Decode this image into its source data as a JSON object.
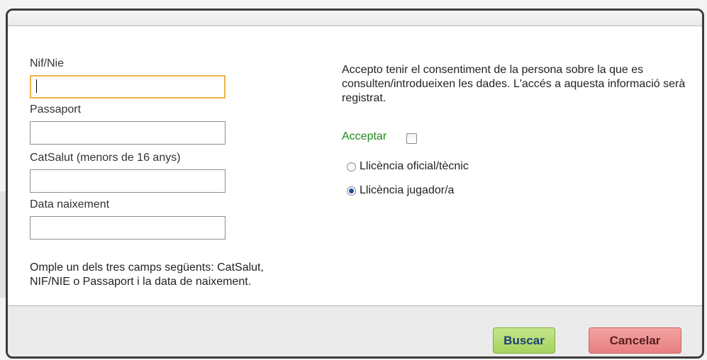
{
  "form": {
    "nif_label": "Nif/Nie",
    "nif_value": "",
    "passport_label": "Passaport",
    "passport_value": "",
    "catsalut_label": "CatSalut (menors de 16 anys)",
    "catsalut_value": "",
    "birthdate_label": "Data naixement",
    "birthdate_value": "",
    "note": "Omple un dels tres camps següents: CatSalut, NIF/NIE o Passaport i la data de naixement."
  },
  "consent": {
    "text": "Accepto tenir el consentiment de la persona sobre la que es consulten/introdueixen les dades. L'accés a aquesta informació serà registrat.",
    "accept_label": "Acceptar",
    "accept_checked": false
  },
  "license": {
    "options": [
      {
        "label": "Llicència oficial/tècnic",
        "selected": false
      },
      {
        "label": "Llicència jugador/a",
        "selected": true
      }
    ]
  },
  "footer": {
    "search_label": "Buscar",
    "cancel_label": "Cancelar"
  },
  "colors": {
    "accept_label": "#1f8a1f",
    "search_button": "#a6d35e",
    "cancel_button": "#e88080",
    "focus_border": "#f0b34a"
  }
}
